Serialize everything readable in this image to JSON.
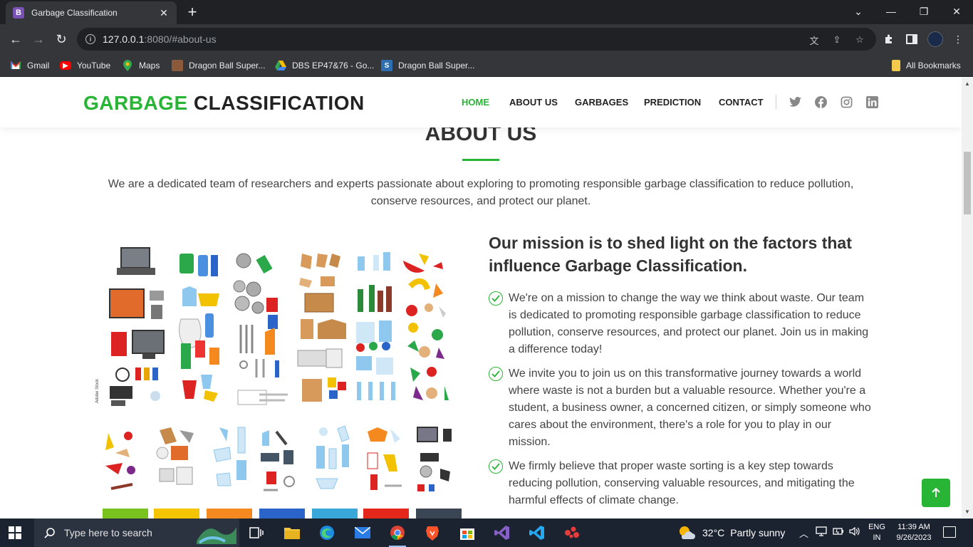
{
  "browser": {
    "tab_title": "Garbage Classification",
    "tab_favicon": "B",
    "url_host": "127.0.0.1",
    "url_rest": ":8080/#about-us",
    "bookmarks": [
      {
        "label": "Gmail",
        "icon": "gmail-icon"
      },
      {
        "label": "YouTube",
        "icon": "youtube-icon"
      },
      {
        "label": "Maps",
        "icon": "maps-icon"
      },
      {
        "label": "Dragon Ball Super...",
        "icon": "site-favicon"
      },
      {
        "label": "DBS EP47&76 - Go...",
        "icon": "drive-icon"
      },
      {
        "label": "Dragon Ball Super...",
        "icon": "site-favicon"
      }
    ],
    "all_bookmarks": "All Bookmarks"
  },
  "site": {
    "logo_green": "GARBAGE",
    "logo_dark": " CLASSIFICATION",
    "nav": [
      "HOME",
      "ABOUT US",
      "GARBAGES",
      "PREDICTION",
      "CONTACT"
    ],
    "active_nav": "HOME",
    "accent_color": "#28b434"
  },
  "about": {
    "title": "ABOUT US",
    "intro": "We are a dedicated team of researchers and experts passionate about exploring to promoting responsible garbage classification to reduce pollution, conserve resources, and protect our planet.",
    "mission_title": "Our mission is to shed light on the factors that influence Garbage Classification.",
    "bullets": [
      "We're on a mission to change the way we think about waste. Our team is dedicated to promoting responsible garbage classification to reduce pollution, conserve resources, and protect our planet. Join us in making a difference today!",
      "We invite you to join us on this transformative journey towards a world where waste is not a burden but a valuable resource. Whether you're a student, a business owner, a concerned citizen, or simply someone who cares about the environment, there's a role for you to play in our mission.",
      "We firmly believe that proper waste sorting is a key step towards reducing pollution, conserving valuable resources, and mitigating the harmful effects of climate change."
    ]
  },
  "taskbar": {
    "search_placeholder": "Type here to search",
    "weather_temp": "32°C",
    "weather_desc": "Partly sunny",
    "lang_1": "ENG",
    "lang_2": "IN",
    "time": "11:39 AM",
    "date": "9/26/2023"
  }
}
